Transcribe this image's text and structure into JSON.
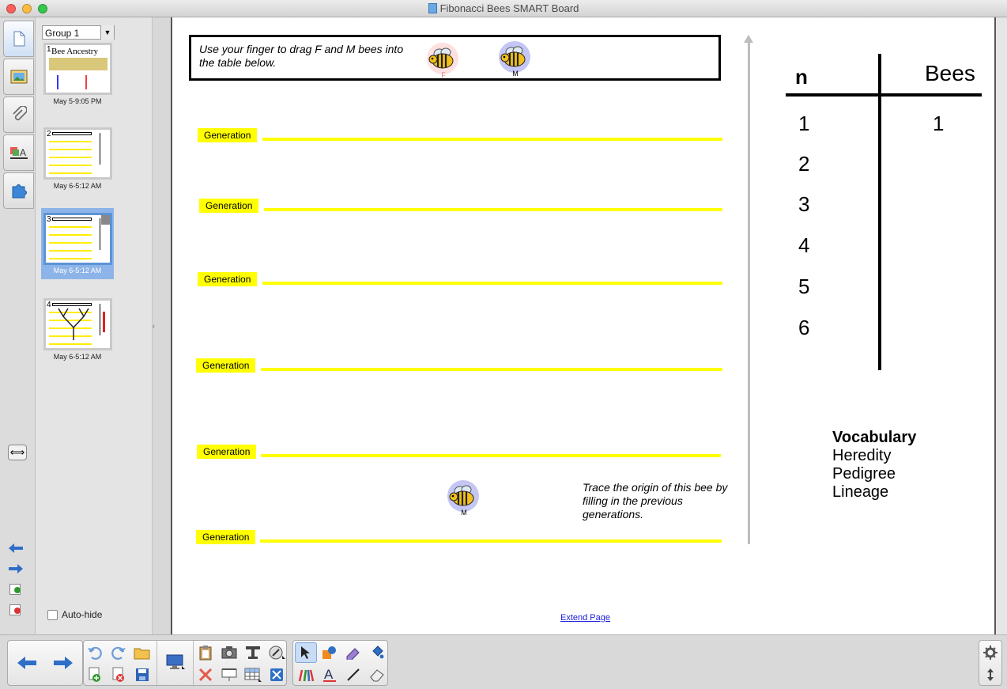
{
  "window": {
    "title": "Fibonacci Bees SMART Board"
  },
  "sorter": {
    "group": "Group 1",
    "pages": [
      {
        "num": "1",
        "title": "Bee Ancestry",
        "caption": "May 5-9:05 PM"
      },
      {
        "num": "2",
        "caption": "May 6-5:12 AM"
      },
      {
        "num": "3",
        "caption": "May 6-5:12 AM"
      },
      {
        "num": "4",
        "caption": "May 6-5:12 AM"
      }
    ],
    "autohide_label": "Auto-hide"
  },
  "canvas": {
    "instruction": "Use your finger to drag F and M bees into the table below.",
    "bee_female_label": "F",
    "bee_male_label": "M",
    "generation_label": "Generation",
    "generations": [
      "Generation",
      "Generation",
      "Generation",
      "Generation",
      "Generation",
      "Generation"
    ],
    "trace_text": "Trace the origin of this bee by filling in the previous generations.",
    "bottom_bee_label": "M",
    "table": {
      "col_n": "n",
      "col_bees": "Bees",
      "n_values": [
        "1",
        "2",
        "3",
        "4",
        "5",
        "6"
      ],
      "bees_values": [
        "1",
        "",
        "",
        "",
        "",
        ""
      ]
    },
    "vocabulary": {
      "title": "Vocabulary",
      "words": [
        "Heredity",
        "Pedigree",
        "Lineage"
      ]
    },
    "extend_page": "Extend Page"
  },
  "colors": {
    "generation_yellow": "#ffff00",
    "male_bee_circle": "#c4c6f4",
    "female_bee_circle": "#fde0e0",
    "selected_thumb": "#8db4e8"
  },
  "icons": {
    "tabs": [
      "page-sorter-icon",
      "gallery-icon",
      "attachments-icon",
      "properties-icon",
      "addons-icon"
    ],
    "toolbar": [
      "previous-page",
      "next-page",
      "undo",
      "redo",
      "open-file",
      "add-page",
      "delete-page",
      "save",
      "display-screen",
      "paste",
      "delete",
      "screen-capture",
      "screen-shade",
      "table",
      "full-screen",
      "insert-table",
      "select",
      "shapes",
      "pens",
      "fill",
      "creative-pens",
      "text",
      "lines",
      "eraser",
      "settings",
      "move-toolbar"
    ]
  }
}
